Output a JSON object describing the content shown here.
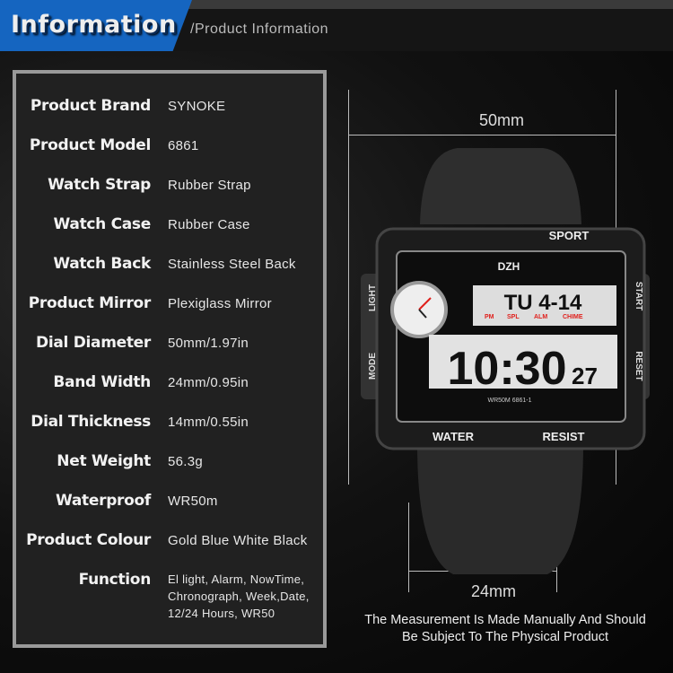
{
  "header": {
    "title": "Information",
    "subtitle": "/Product Information"
  },
  "specs": [
    {
      "label": "Product Brand",
      "value": "SYNOKE"
    },
    {
      "label": "Product Model",
      "value": "6861"
    },
    {
      "label": "Watch Strap",
      "value": "Rubber Strap"
    },
    {
      "label": "Watch Case",
      "value": "Rubber Case"
    },
    {
      "label": "Watch Back",
      "value": "Stainless Steel Back"
    },
    {
      "label": "Product Mirror",
      "value": "Plexiglass Mirror"
    },
    {
      "label": "Dial Diameter",
      "value": "50mm/1.97in"
    },
    {
      "label": "Band Width",
      "value": "24mm/0.95in"
    },
    {
      "label": "Dial Thickness",
      "value": "14mm/0.55in"
    },
    {
      "label": "Net Weight",
      "value": "56.3g"
    },
    {
      "label": "Waterproof",
      "value": "WR50m"
    },
    {
      "label": "Product Colour",
      "value": "Gold Blue White Black"
    }
  ],
  "function": {
    "label": "Function",
    "lines": [
      "El light, Alarm, NowTime,",
      "Chronograph, Week,Date,",
      "12/24 Hours,  WR50"
    ]
  },
  "dimensions": {
    "width": "50mm",
    "band": "24mm"
  },
  "note": {
    "line1": "The Measurement Is Made Manually And Should",
    "line2": "Be Subject To The Physical Product"
  },
  "watch": {
    "top": "SPORT",
    "brand": "DZH",
    "left_top": "LIGHT",
    "left_bottom": "MODE",
    "right_top": "START",
    "right_bottom": "RESET",
    "bottom_left": "WATER",
    "bottom_right": "RESIST",
    "model": "WR50M 6861-1",
    "upper_display": "TU 4-14",
    "indicators": [
      "PM",
      "SPL",
      "ALM",
      "CHIME"
    ],
    "time": "10:30",
    "seconds": "27"
  },
  "colors": {
    "accent": "#1565c0",
    "indicator": "#e0201c"
  }
}
